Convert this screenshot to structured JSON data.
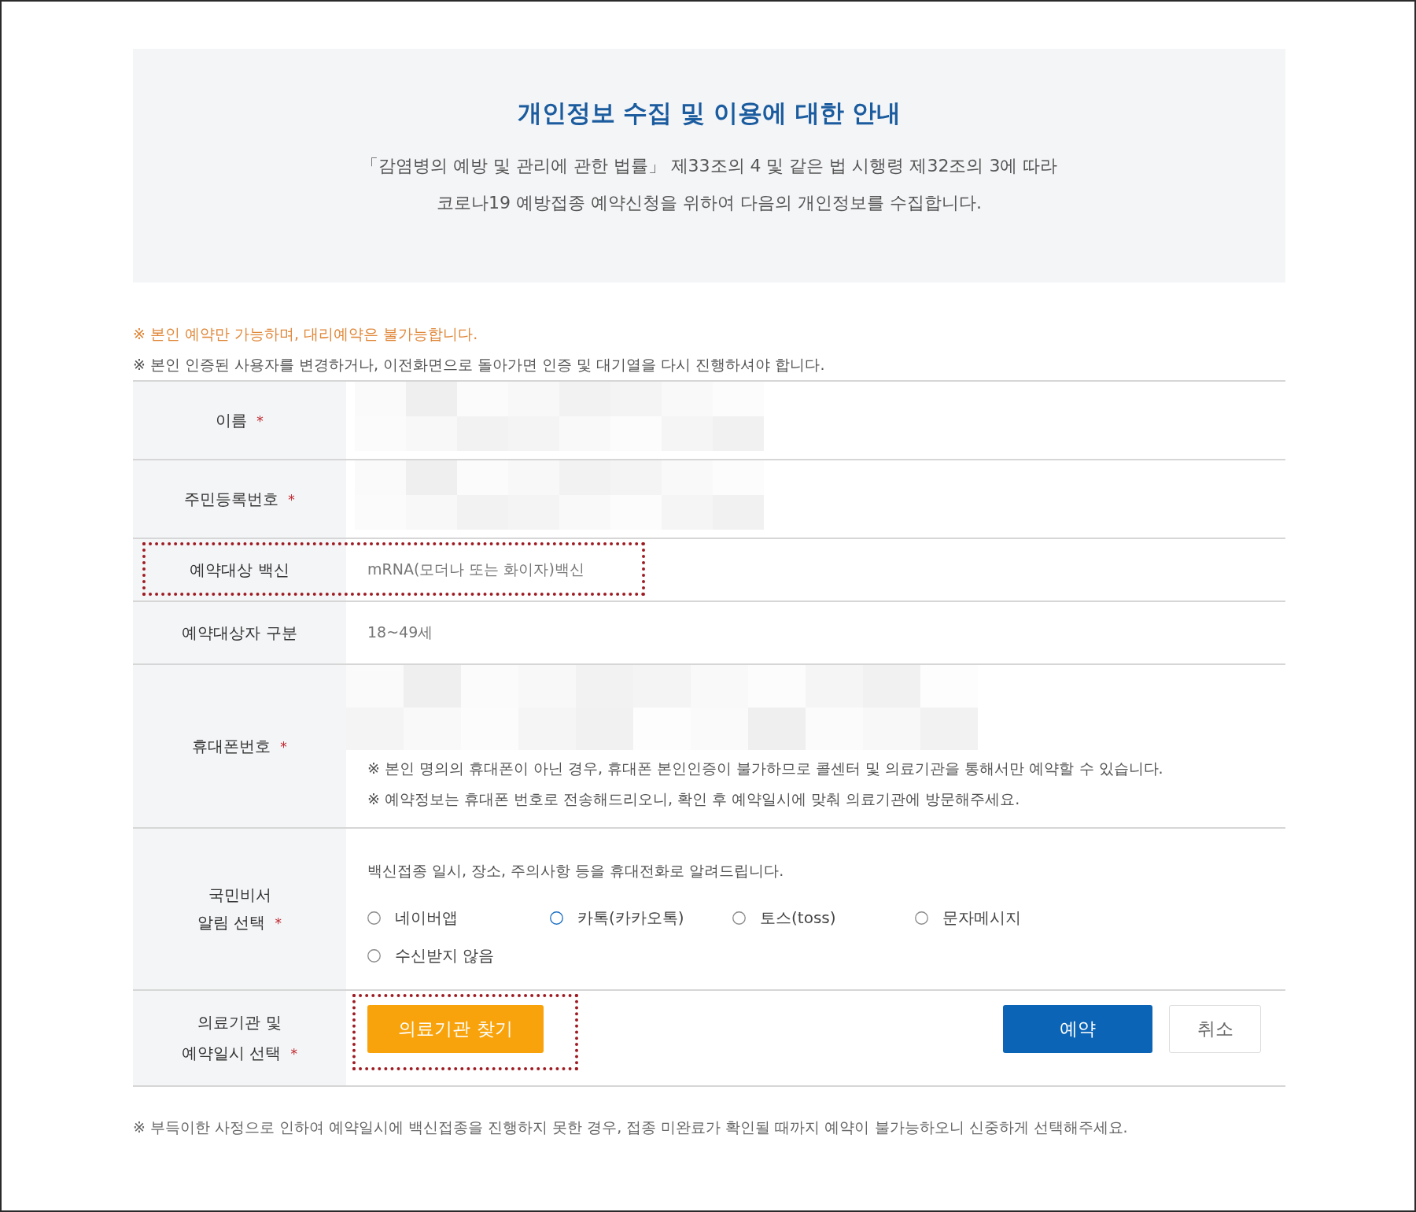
{
  "notice": {
    "title": "개인정보 수집 및 이용에 대한 안내",
    "lines": [
      "「감염병의 예방 및 관리에 관한 법률」 제33조의 4 및 같은 법 시행령 제32조의 3에 따라",
      "코로나19 예방접종 예약신청을 위하여 다음의 개인정보를 수집합니다."
    ]
  },
  "warnings": [
    {
      "kind": "emphasis",
      "text": "※ 본인 예약만 가능하며, 대리예약은 불가능합니다."
    },
    {
      "kind": "plain",
      "text": "※ 본인 인증된 사용자를 변경하거나, 이전화면으로 돌아가면 인증 및 대기열을 다시 진행하셔야 합니다."
    }
  ],
  "form": {
    "rows": [
      {
        "kind": "redacted",
        "label": [
          "이름"
        ],
        "required_mark": "*",
        "highlighted": false
      },
      {
        "kind": "redacted",
        "label": [
          "주민등록번호"
        ],
        "required_mark": "*",
        "highlighted": false
      },
      {
        "kind": "text",
        "label": [
          "예약대상 백신"
        ],
        "value": "mRNA(모더나 또는 화이자)백신",
        "highlighted": true
      },
      {
        "kind": "text",
        "label": [
          "예약대상자 구분"
        ],
        "value": "18~49세",
        "highlighted": false
      },
      {
        "kind": "phone",
        "label": [
          "휴대폰번호"
        ],
        "required_mark": "*",
        "notes": [
          "※ 본인 명의의 휴대폰이 아닌 경우, 휴대폰 본인인증이 불가하므로 콜센터 및 의료기관을 통해서만 예약할 수 있습니다.",
          "※ 예약정보는 휴대폰 번호로 전송해드리오니, 확인 후 예약일시에 맞춰 의료기관에 방문해주세요."
        ],
        "highlighted": false
      },
      {
        "kind": "radio",
        "label": [
          "국민비서",
          "알림 선택"
        ],
        "required_mark": "*",
        "intro": "백신접종 일시, 장소, 주의사항 등을 휴대전화로 알려드립니다.",
        "options": [
          {
            "label": "네이버앱",
            "selected": false
          },
          {
            "label": "카톡(카카오톡)",
            "selected": true
          },
          {
            "label": "토스(toss)",
            "selected": false
          },
          {
            "label": "문자메시지",
            "selected": false
          },
          {
            "label": "수신받지 않음",
            "selected": false
          }
        ],
        "highlighted": false
      },
      {
        "kind": "actions",
        "label": [
          "의료기관 및",
          "예약일시 선택"
        ],
        "required_mark": "*",
        "buttons": [
          {
            "kind": "find",
            "label": "의료기관 찾기",
            "highlighted": true
          },
          {
            "kind": "primary",
            "label": "예약",
            "highlighted": false
          },
          {
            "kind": "secondary",
            "label": "취소",
            "highlighted": false
          }
        ],
        "highlighted": false
      }
    ]
  },
  "footer_note": "※ 부득이한 사정으로 인하여 예약일시에 백신접종을 진행하지 못한 경우, 접종 미완료가 확인될 때까지 예약이 불가능하오니 신중하게 선택해주세요."
}
